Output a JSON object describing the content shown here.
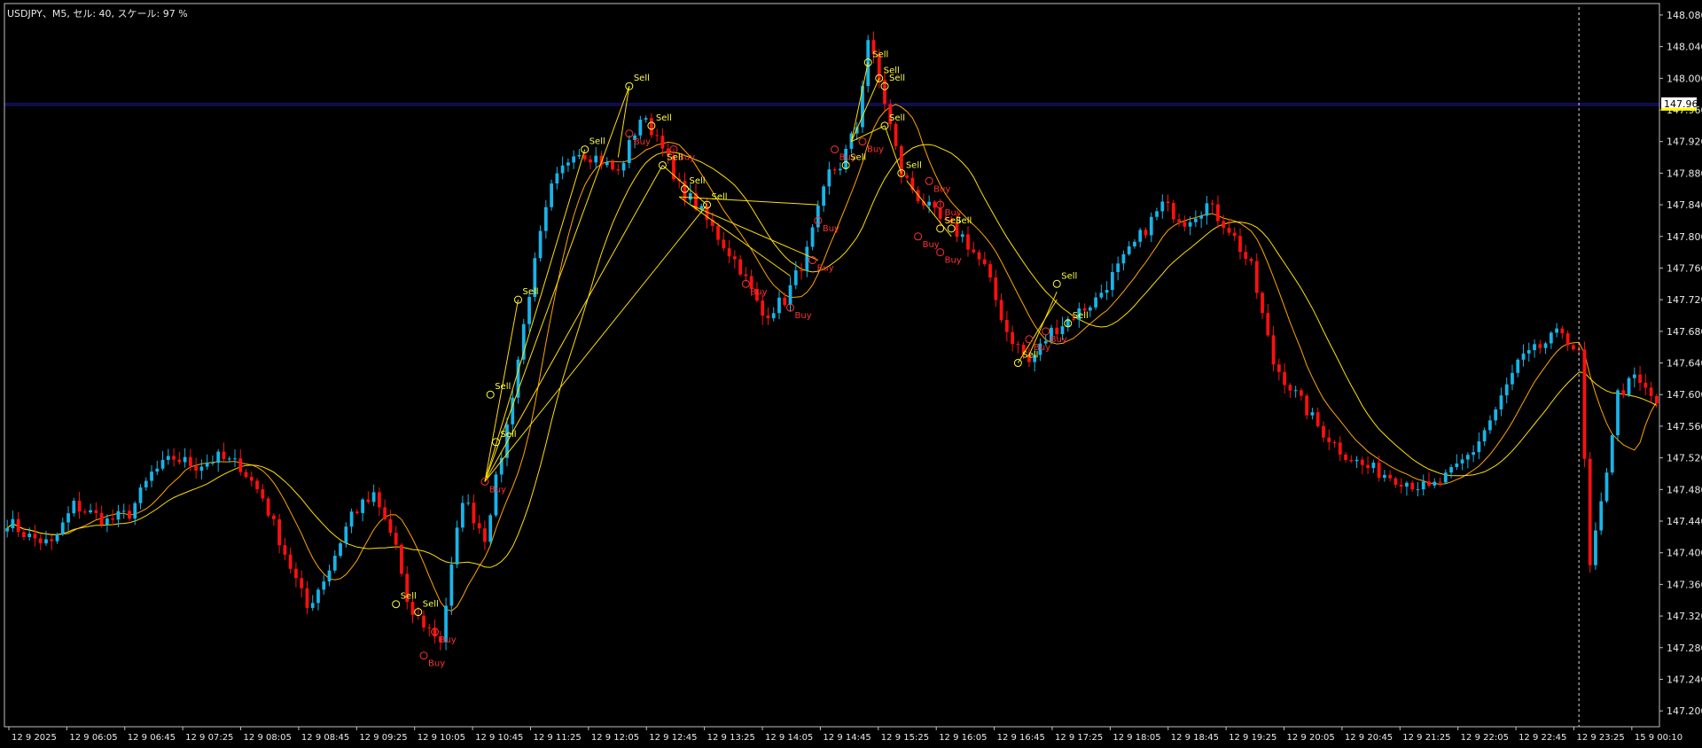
{
  "header": {
    "title": "USDJPY、M5, セル: 40, スケール: 97 %"
  },
  "colors": {
    "background": "#000000",
    "frame": "#c0c0c0",
    "bull": "#18b4e8",
    "bear": "#ff1010",
    "ma_fast": "#ffa500",
    "ma_slow": "#ffe000",
    "signal_sell": "#ffff40",
    "signal_buy": "#ff3030",
    "bid_line": "#1e1e9a",
    "price_box": "#ffffff",
    "price_box_accent": "#ffff00",
    "period_sep": "#dcdcdc"
  },
  "chart_data": {
    "type": "candlestick",
    "symbol": "USDJPY",
    "timeframe": "M5",
    "ylim": [
      147.18,
      148.09
    ],
    "y_ticks": [
      "148.080",
      "148.040",
      "148.000",
      "147.960",
      "147.920",
      "147.880",
      "147.840",
      "147.800",
      "147.760",
      "147.720",
      "147.680",
      "147.640",
      "147.600",
      "147.560",
      "147.520",
      "147.480",
      "147.440",
      "147.400",
      "147.360",
      "147.320",
      "147.280",
      "147.240",
      "147.200"
    ],
    "x_ticks": [
      "12 9 2025",
      "12 9 06:05",
      "12 9 06:45",
      "12 9 07:25",
      "12 9 08:05",
      "12 9 08:45",
      "12 9 09:25",
      "12 9 10:05",
      "12 9 10:45",
      "12 9 11:25",
      "12 9 12:05",
      "12 9 12:45",
      "12 9 13:25",
      "12 9 14:05",
      "12 9 14:45",
      "12 9 15:25",
      "12 9 16:05",
      "12 9 16:45",
      "12 9 17:25",
      "12 9 18:05",
      "12 9 18:45",
      "12 9 19:25",
      "12 9 20:05",
      "12 9 20:45",
      "12 9 21:25",
      "12 9 22:05",
      "12 9 22:45",
      "12 9 23:25",
      "15 9 00:10"
    ],
    "current_price": "147.968",
    "current_price_value": 147.968,
    "period_separator_index": 283,
    "ma_series": [
      {
        "period": 10,
        "color": "ma_fast"
      },
      {
        "period": 20,
        "color": "ma_slow"
      }
    ],
    "close_anchors": [
      [
        0,
        147.44
      ],
      [
        4,
        147.42
      ],
      [
        8,
        147.41
      ],
      [
        12,
        147.46
      ],
      [
        18,
        147.44
      ],
      [
        22,
        147.45
      ],
      [
        26,
        147.5
      ],
      [
        30,
        147.52
      ],
      [
        34,
        147.51
      ],
      [
        38,
        147.52
      ],
      [
        42,
        147.51
      ],
      [
        46,
        147.47
      ],
      [
        50,
        147.4
      ],
      [
        54,
        147.33
      ],
      [
        58,
        147.38
      ],
      [
        62,
        147.45
      ],
      [
        66,
        147.47
      ],
      [
        70,
        147.41
      ],
      [
        72,
        147.33
      ],
      [
        75,
        147.31
      ],
      [
        78,
        147.29
      ],
      [
        82,
        147.47
      ],
      [
        86,
        147.42
      ],
      [
        90,
        147.56
      ],
      [
        94,
        147.73
      ],
      [
        96,
        147.8
      ],
      [
        98,
        147.86
      ],
      [
        102,
        147.91
      ],
      [
        106,
        147.9
      ],
      [
        110,
        147.88
      ],
      [
        114,
        147.95
      ],
      [
        118,
        147.92
      ],
      [
        120,
        147.87
      ],
      [
        124,
        147.84
      ],
      [
        128,
        147.8
      ],
      [
        132,
        147.76
      ],
      [
        136,
        147.7
      ],
      [
        140,
        147.72
      ],
      [
        144,
        147.78
      ],
      [
        148,
        147.88
      ],
      [
        150,
        147.89
      ],
      [
        153,
        147.94
      ],
      [
        155,
        148.05
      ],
      [
        158,
        147.97
      ],
      [
        161,
        147.88
      ],
      [
        164,
        147.85
      ],
      [
        168,
        147.82
      ],
      [
        172,
        147.8
      ],
      [
        176,
        147.76
      ],
      [
        180,
        147.68
      ],
      [
        184,
        147.64
      ],
      [
        188,
        147.68
      ],
      [
        192,
        147.7
      ],
      [
        196,
        147.72
      ],
      [
        200,
        147.76
      ],
      [
        204,
        147.8
      ],
      [
        208,
        147.84
      ],
      [
        212,
        147.82
      ],
      [
        216,
        147.84
      ],
      [
        220,
        147.81
      ],
      [
        224,
        147.76
      ],
      [
        228,
        147.64
      ],
      [
        232,
        147.6
      ],
      [
        236,
        147.56
      ],
      [
        240,
        147.53
      ],
      [
        244,
        147.51
      ],
      [
        248,
        147.5
      ],
      [
        252,
        147.49
      ],
      [
        256,
        147.48
      ],
      [
        260,
        147.5
      ],
      [
        264,
        147.53
      ],
      [
        268,
        147.58
      ],
      [
        272,
        147.64
      ],
      [
        276,
        147.66
      ],
      [
        280,
        147.68
      ],
      [
        283,
        147.65
      ],
      [
        285,
        147.38
      ],
      [
        287,
        147.46
      ],
      [
        290,
        147.6
      ],
      [
        293,
        147.62
      ],
      [
        297,
        147.59
      ]
    ],
    "signals": [
      {
        "label": "Sell",
        "index": 70,
        "price": 147.335
      },
      {
        "label": "Sell",
        "index": 74,
        "price": 147.325
      },
      {
        "label": "Buy",
        "index": 77,
        "price": 147.3
      },
      {
        "label": "Buy",
        "index": 75,
        "price": 147.27
      },
      {
        "label": "Buy",
        "index": 86,
        "price": 147.49
      },
      {
        "label": "Sell",
        "index": 87,
        "price": 147.6
      },
      {
        "label": "Sell",
        "index": 88,
        "price": 147.54
      },
      {
        "label": "Sell",
        "index": 92,
        "price": 147.72
      },
      {
        "label": "Sell",
        "index": 104,
        "price": 147.91
      },
      {
        "label": "Sell",
        "index": 112,
        "price": 147.99
      },
      {
        "label": "Buy",
        "index": 112,
        "price": 147.93
      },
      {
        "label": "Sell",
        "index": 116,
        "price": 147.94
      },
      {
        "label": "Buy",
        "index": 120,
        "price": 147.91
      },
      {
        "label": "Sell",
        "index": 118,
        "price": 147.89
      },
      {
        "label": "Sell",
        "index": 122,
        "price": 147.86
      },
      {
        "label": "Sell",
        "index": 126,
        "price": 147.84
      },
      {
        "label": "Buy",
        "index": 133,
        "price": 147.74
      },
      {
        "label": "Buy",
        "index": 141,
        "price": 147.71
      },
      {
        "label": "Buy",
        "index": 146,
        "price": 147.82
      },
      {
        "label": "Buy",
        "index": 145,
        "price": 147.77
      },
      {
        "label": "Buy",
        "index": 149,
        "price": 147.91
      },
      {
        "label": "Sell",
        "index": 151,
        "price": 147.89
      },
      {
        "label": "Sell",
        "index": 155,
        "price": 148.02
      },
      {
        "label": "Sell",
        "index": 157,
        "price": 148.0
      },
      {
        "label": "Sell",
        "index": 158,
        "price": 147.99
      },
      {
        "label": "Buy",
        "index": 154,
        "price": 147.92
      },
      {
        "label": "Sell",
        "index": 158,
        "price": 147.94
      },
      {
        "label": "Sell",
        "index": 161,
        "price": 147.88
      },
      {
        "label": "Buy",
        "index": 166,
        "price": 147.87
      },
      {
        "label": "Buy",
        "index": 168,
        "price": 147.84
      },
      {
        "label": "Buy",
        "index": 164,
        "price": 147.8
      },
      {
        "label": "Sell",
        "index": 168,
        "price": 147.81
      },
      {
        "label": "Sell",
        "index": 170,
        "price": 147.81
      },
      {
        "label": "Buy",
        "index": 168,
        "price": 147.78
      },
      {
        "label": "Sell",
        "index": 182,
        "price": 147.64
      },
      {
        "label": "Buy",
        "index": 184,
        "price": 147.67
      },
      {
        "label": "Sell",
        "index": 189,
        "price": 147.74
      },
      {
        "label": "Buy",
        "index": 187,
        "price": 147.68
      },
      {
        "label": "Sell",
        "index": 191,
        "price": 147.69
      }
    ],
    "signal_lines": [
      [
        86,
        147.49,
        92,
        147.72
      ],
      [
        86,
        147.49,
        104,
        147.91
      ],
      [
        86,
        147.49,
        112,
        147.99
      ],
      [
        86,
        147.49,
        118,
        147.89
      ],
      [
        86,
        147.49,
        126,
        147.84
      ],
      [
        110,
        147.9,
        112,
        147.99
      ],
      [
        118,
        147.89,
        126,
        147.84
      ],
      [
        121,
        147.85,
        146,
        147.84
      ],
      [
        121,
        147.85,
        141,
        147.75
      ],
      [
        123,
        147.84,
        146,
        147.77
      ],
      [
        152,
        147.92,
        155,
        148.02
      ],
      [
        152,
        147.92,
        157,
        148.0
      ],
      [
        152,
        147.92,
        158,
        147.94
      ],
      [
        158,
        147.94,
        161,
        147.88
      ],
      [
        162,
        147.87,
        170,
        147.8
      ],
      [
        184,
        147.65,
        189,
        147.73
      ],
      [
        182,
        147.64,
        189,
        147.72
      ]
    ]
  }
}
